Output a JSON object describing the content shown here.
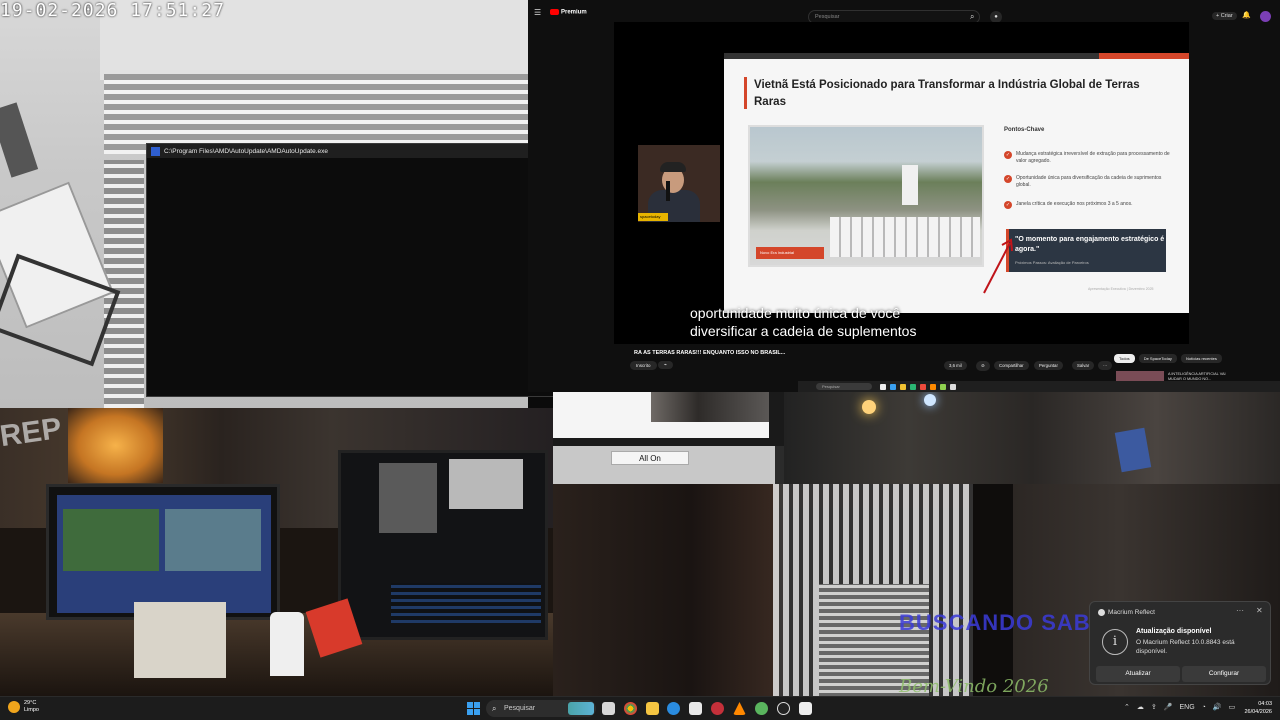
{
  "camera_top_left": {
    "timestamp": "19-02-2026 17:51:27"
  },
  "console_window": {
    "title": "C:\\Program Files\\AMD\\AutoUpdate\\AMDAutoUpdate.exe",
    "minimize": "–",
    "maximize": "☐",
    "close": "✕"
  },
  "youtube": {
    "logo": "Premium",
    "search_placeholder": "Pesquisar",
    "create_label": "+ Criar",
    "video_title": "RA AS TERRAS RARAS!!! ENQUANTO ISSO NO BRASIL...",
    "subscribe": "Inscrito",
    "actions": {
      "likes": "3,6 mil",
      "share": "Compartilhar",
      "ask": "Perguntar",
      "save": "Salvar",
      "more": "···"
    },
    "chips": [
      "Todos",
      "De SpaceToday",
      "Notícias recentes"
    ],
    "recommended": "A INTELIGÊNCIA ARTIFICIAL VAI MUDAR O MUNDO NO...",
    "pip_tag": "spacetoday",
    "caption_lines": [
      "oportunidade muito única de você",
      "diversificar a cadeia de suplementos"
    ],
    "inner_taskbar_search": "Pesquisar"
  },
  "slide": {
    "title": "Vietnã Está Posicionado para Transformar a Indústria Global de Terras Raras",
    "key_points_title": "Pontos-Chave",
    "key_points": [
      "Mudança estratégica irreversível de extração para processamento de valor agregado.",
      "Oportunidade única para diversificação da cadeia de suprimentos global.",
      "Janela crítica de execução nos próximos 3 a 5 anos."
    ],
    "photo_banner": "Novo Era Industrial",
    "quote": "\"O momento para engajamento estratégico é agora.\"",
    "quote_sub": "Próximos Passos: Avaliação de Parceiros",
    "footer": "Apresentação Executiva | Dezembro 2025"
  },
  "control_strip": {
    "all_on_button": "All On"
  },
  "overlays": {
    "blue_text": "BUSCANDO SAB",
    "green_text": "Bem-Vindo 2026"
  },
  "toast": {
    "app_name": "Macrium Reflect",
    "heading": "Atualização disponível",
    "body": "O Macrium Reflect 10.0.8843 está disponível.",
    "primary_button": "Atualizar",
    "secondary_button": "Configurar",
    "more": "···",
    "close": "✕"
  },
  "taskbar": {
    "weather_temp": "29°C",
    "weather_desc": "Limpo",
    "search_label": "Pesquisar",
    "language": "ENG",
    "time": "04:03",
    "date": "26/04/2026"
  },
  "colors": {
    "accent_red": "#d4462a",
    "youtube_red": "#ff0000",
    "windows_blue": "#3aa0f0",
    "toast_bg": "#2b2b2b"
  }
}
